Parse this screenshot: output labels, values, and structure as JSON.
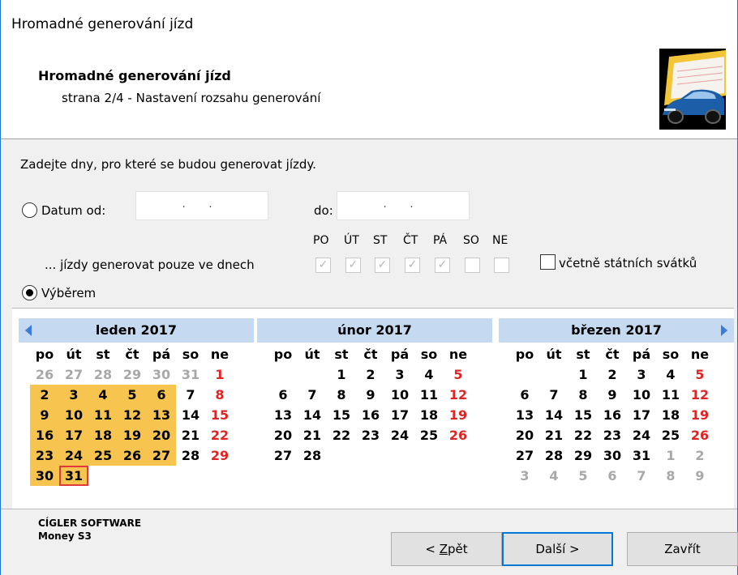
{
  "window": {
    "title": "Hromadné generování jízd"
  },
  "header": {
    "title": "Hromadné generování jízd",
    "subtitle": "strana 2/4 - Nastavení rozsahu generování",
    "logo_icon": "car-icon"
  },
  "form": {
    "instruction": "Zadejte dny, pro které se budou generovat jízdy.",
    "date_from_label": "Datum od:",
    "date_from_value": ". .",
    "date_to_label": "do:",
    "date_to_value": ". .",
    "weekday_heads": [
      "PO",
      "ÚT",
      "ST",
      "ČT",
      "PÁ",
      "SO",
      "NE"
    ],
    "weekday_checked": [
      true,
      true,
      true,
      true,
      true,
      false,
      false
    ],
    "weekdays_label": "... jízdy generovat pouze ve dnech",
    "holidays_label": "včetně státních svátků",
    "holidays_checked": false,
    "selection_label": "Výběrem",
    "mode": "selection"
  },
  "calendar": {
    "weekday_labels": [
      "po",
      "út",
      "st",
      "čt",
      "pá",
      "so",
      "ne"
    ],
    "months": [
      {
        "title": "leden 2017",
        "weeks": [
          [
            "26",
            "27",
            "28",
            "29",
            "30",
            "31",
            "1"
          ],
          [
            "2",
            "3",
            "4",
            "5",
            "6",
            "7",
            "8"
          ],
          [
            "9",
            "10",
            "11",
            "12",
            "13",
            "14",
            "15"
          ],
          [
            "16",
            "17",
            "18",
            "19",
            "20",
            "21",
            "22"
          ],
          [
            "23",
            "24",
            "25",
            "26",
            "27",
            "28",
            "29"
          ],
          [
            "30",
            "31",
            "",
            "",
            "",
            "",
            ""
          ]
        ]
      },
      {
        "title": "únor 2017",
        "weeks": [
          [
            "",
            "",
            "1",
            "2",
            "3",
            "4",
            "5"
          ],
          [
            "6",
            "7",
            "8",
            "9",
            "10",
            "11",
            "12"
          ],
          [
            "13",
            "14",
            "15",
            "16",
            "17",
            "18",
            "19"
          ],
          [
            "20",
            "21",
            "22",
            "23",
            "24",
            "25",
            "26"
          ],
          [
            "27",
            "28",
            "",
            "",
            "",
            "",
            ""
          ],
          [
            "",
            "",
            "",
            "",
            "",
            "",
            ""
          ]
        ]
      },
      {
        "title": "březen 2017",
        "weeks": [
          [
            "",
            "",
            "1",
            "2",
            "3",
            "4",
            "5"
          ],
          [
            "6",
            "7",
            "8",
            "9",
            "10",
            "11",
            "12"
          ],
          [
            "13",
            "14",
            "15",
            "16",
            "17",
            "18",
            "19"
          ],
          [
            "20",
            "21",
            "22",
            "23",
            "24",
            "25",
            "26"
          ],
          [
            "27",
            "28",
            "29",
            "30",
            "31",
            "1",
            "2"
          ],
          [
            "3",
            "4",
            "5",
            "6",
            "7",
            "8",
            "9"
          ]
        ]
      }
    ],
    "colors": {
      "selected": "#f7c54f",
      "sunday": "#e02424",
      "header": "#c5daf1",
      "today_border": "#e03b3b"
    }
  },
  "footer": {
    "company": "CÍGLER SOFTWARE",
    "product": "Money S3",
    "back_prefix": "< ",
    "back_mnemonic": "Z",
    "back_rest": "pět",
    "next_label": "Další >",
    "close_label": "Zavřít"
  }
}
